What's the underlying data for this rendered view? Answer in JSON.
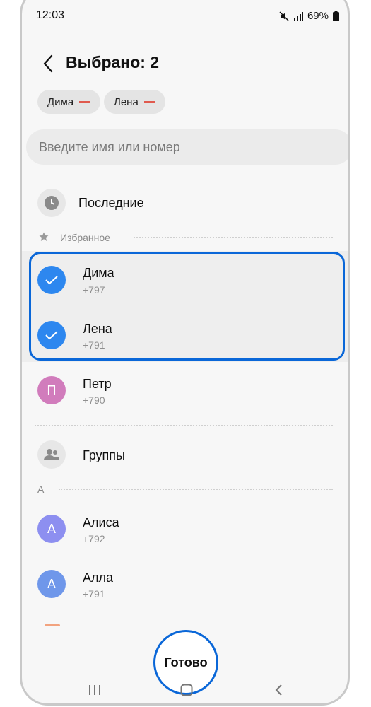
{
  "status": {
    "time": "12:03",
    "battery": "69%"
  },
  "header": {
    "title": "Выбрано: 2"
  },
  "chips": [
    {
      "label": "Дима"
    },
    {
      "label": "Лена"
    }
  ],
  "search": {
    "placeholder": "Введите имя или номер"
  },
  "recent": {
    "label": "Последние"
  },
  "favorites": {
    "section_label": "Избранное",
    "items": [
      {
        "name": "Дима",
        "phone": "+797",
        "selected": true
      },
      {
        "name": "Лена",
        "phone": "+791",
        "selected": true
      }
    ]
  },
  "contacts_other": [
    {
      "name": "Петр",
      "phone": "+790",
      "initial": "П"
    }
  ],
  "groups": {
    "label": "Группы"
  },
  "section_a": {
    "letter": "А",
    "items": [
      {
        "name": "Алиса",
        "phone": "+792",
        "initial": "А"
      },
      {
        "name": "Алла",
        "phone": "+791",
        "initial": "А"
      }
    ]
  },
  "done_button": {
    "label": "Готово"
  },
  "colors": {
    "accent": "#0a67d8",
    "check": "#2d87ef",
    "chip_minus": "#e05a4e"
  }
}
